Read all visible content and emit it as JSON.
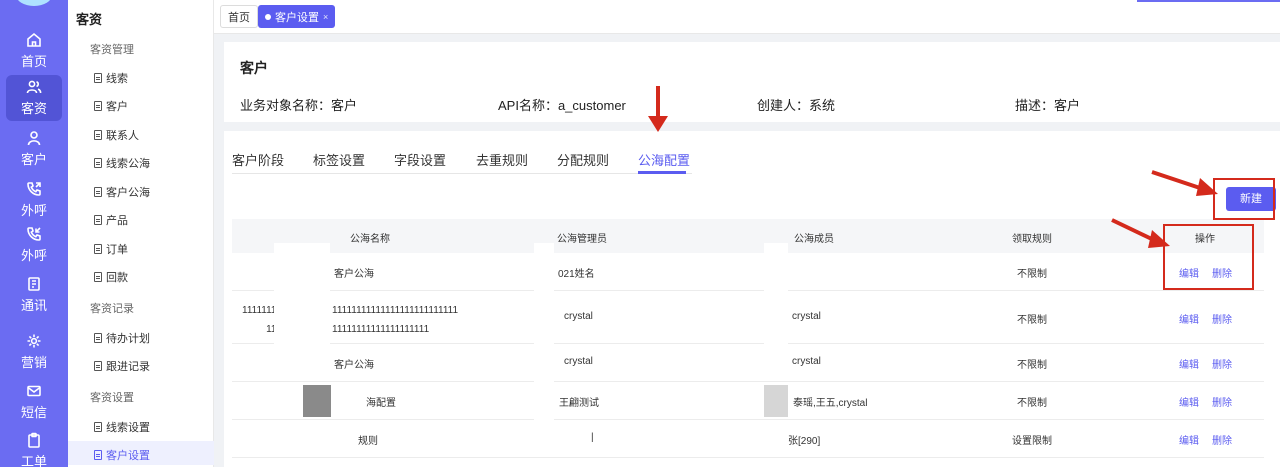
{
  "rail": {
    "items": [
      {
        "label": "首页",
        "icon": "home-icon"
      },
      {
        "label": "客资",
        "icon": "users-icon"
      },
      {
        "label": "客户",
        "icon": "user-icon"
      },
      {
        "label": "外呼",
        "icon": "phone-out-icon"
      },
      {
        "label": "外呼",
        "icon": "phone-in-icon"
      },
      {
        "label": "通讯",
        "icon": "book-icon"
      },
      {
        "label": "营销",
        "icon": "gear-icon"
      },
      {
        "label": "短信",
        "icon": "mail-icon"
      },
      {
        "label": "工单",
        "icon": "clipboard-icon"
      }
    ],
    "active_index": 1
  },
  "menu": {
    "title": "客资",
    "groups": [
      {
        "heading": "客资管理",
        "items": [
          "线索",
          "客户",
          "联系人",
          "线索公海",
          "客户公海",
          "产品",
          "订单",
          "回款"
        ]
      },
      {
        "heading": "客资记录",
        "items": [
          "待办计划",
          "跟进记录"
        ]
      },
      {
        "heading": "客资设置",
        "items": [
          "线索设置",
          "客户设置"
        ]
      }
    ],
    "active_item": "客户设置"
  },
  "tabs": {
    "home": "首页",
    "current": "客户设置",
    "close": "×"
  },
  "object": {
    "title": "客户",
    "biz_name": "业务对象名称：客户",
    "api_name": "API名称：a_customer",
    "creator": "创建人：系统",
    "desc": "描述：客户"
  },
  "subtabs": [
    "客户阶段",
    "标签设置",
    "字段设置",
    "去重规则",
    "分配规则",
    "公海配置"
  ],
  "active_subtab": "公海配置",
  "new_button": "新建",
  "table": {
    "columns": [
      "公海名称",
      "公海管理员",
      "公海成员",
      "领取规则",
      "操作"
    ],
    "rows": [
      {
        "prefix": "",
        "name": "客户公海",
        "admin": "021姓名",
        "members": "",
        "rule": "不限制"
      },
      {
        "prefix": "1111111\n11",
        "name": "11111111111111111111111111\n11111111111111111111",
        "admin": "crystal",
        "members": "crystal",
        "rule": "不限制"
      },
      {
        "prefix": "",
        "name": "客户公海",
        "admin": "crystal",
        "members": "crystal",
        "rule": "不限制"
      },
      {
        "prefix": "",
        "name": "海配置",
        "admin": "王翩测试",
        "members": "泰瑶,王五,crystal",
        "rule": "不限制"
      },
      {
        "prefix": "",
        "name": "规则",
        "admin": "|",
        "members": "张[290]",
        "rule": "设置限制"
      }
    ],
    "actions": {
      "edit": "编辑",
      "delete": "删除"
    }
  },
  "colors": {
    "accent": "#5b5cf0",
    "rail": "#6b6cf2",
    "annotation": "#d42a1c"
  }
}
